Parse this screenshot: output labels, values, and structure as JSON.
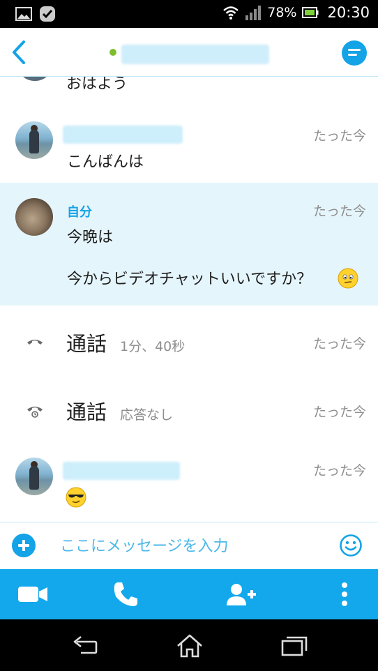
{
  "status_bar": {
    "battery_percent": "78%",
    "time": "20:30"
  },
  "header": {
    "back_icon": "chevron-left-icon",
    "menu_icon": "menu-icon",
    "presence_color": "#7cbe2e",
    "accent_color": "#13a3e6"
  },
  "feed": {
    "previous_text": "おはよう",
    "messages": [
      {
        "sender": "",
        "time": "たった今",
        "text": "こんばんは"
      },
      {
        "sender": "自分",
        "time": "たった今",
        "text": "今晩は",
        "text2": "今からビデオチャットいいですか？"
      },
      {
        "type": "call",
        "label": "通話",
        "detail": "1分、40秒",
        "time": "たった今"
      },
      {
        "type": "call",
        "label": "通話",
        "detail": "応答なし",
        "time": "たった今"
      },
      {
        "sender": "",
        "time": "たった今",
        "emoji": "sunglasses-emoji"
      }
    ]
  },
  "composer": {
    "placeholder": "ここにメッセージを入力",
    "plus_icon": "plus-icon",
    "emoticon_icon": "smiley-icon"
  },
  "action_bar": {
    "color": "#13a8ec",
    "items": [
      "video-call-icon",
      "phone-icon",
      "add-person-icon",
      "more-vertical-icon"
    ]
  }
}
